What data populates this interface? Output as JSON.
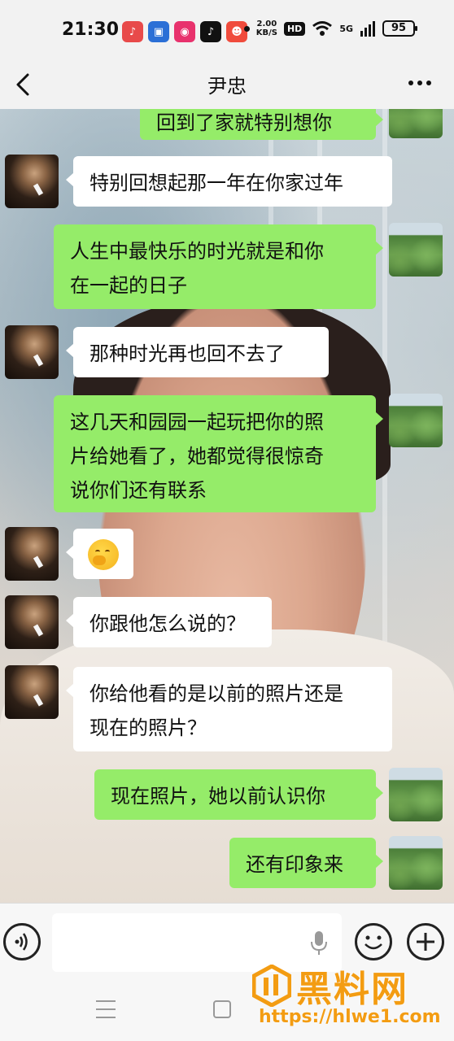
{
  "status_bar": {
    "time": "21:30",
    "net_speed_value": "2.00",
    "net_speed_unit": "KB/S",
    "hd": "HD",
    "network": "5G",
    "battery": "95"
  },
  "header": {
    "title": "尹忠"
  },
  "messages": [
    {
      "side": "right",
      "text": "回到了家就特别想你"
    },
    {
      "side": "left",
      "text": "特别回想起那一年在你家过年"
    },
    {
      "side": "right",
      "line1": "人生中最快乐的时光就是和你",
      "line2": "在一起的日子"
    },
    {
      "side": "left",
      "text": "那种时光再也回不去了"
    },
    {
      "side": "right",
      "line1": "这几天和园园一起玩把你的照",
      "line2": "片给她看了，她都觉得很惊奇",
      "line3": "说你们还有联系"
    },
    {
      "side": "left",
      "emoji": "shy-emoji"
    },
    {
      "side": "left",
      "text": "你跟他怎么说的？"
    },
    {
      "side": "left",
      "line1": "你给他看的是以前的照片还是",
      "line2": "现在的照片？"
    },
    {
      "side": "right",
      "text": "现在照片，她以前认识你"
    },
    {
      "side": "right",
      "text": "还有印象来"
    }
  ],
  "watermark": {
    "title": "黑料网",
    "url": "https://hlwe1.com"
  },
  "colors": {
    "bubble_right": "#95ec69",
    "bubble_left": "#ffffff",
    "watermark": "#f39c12"
  }
}
